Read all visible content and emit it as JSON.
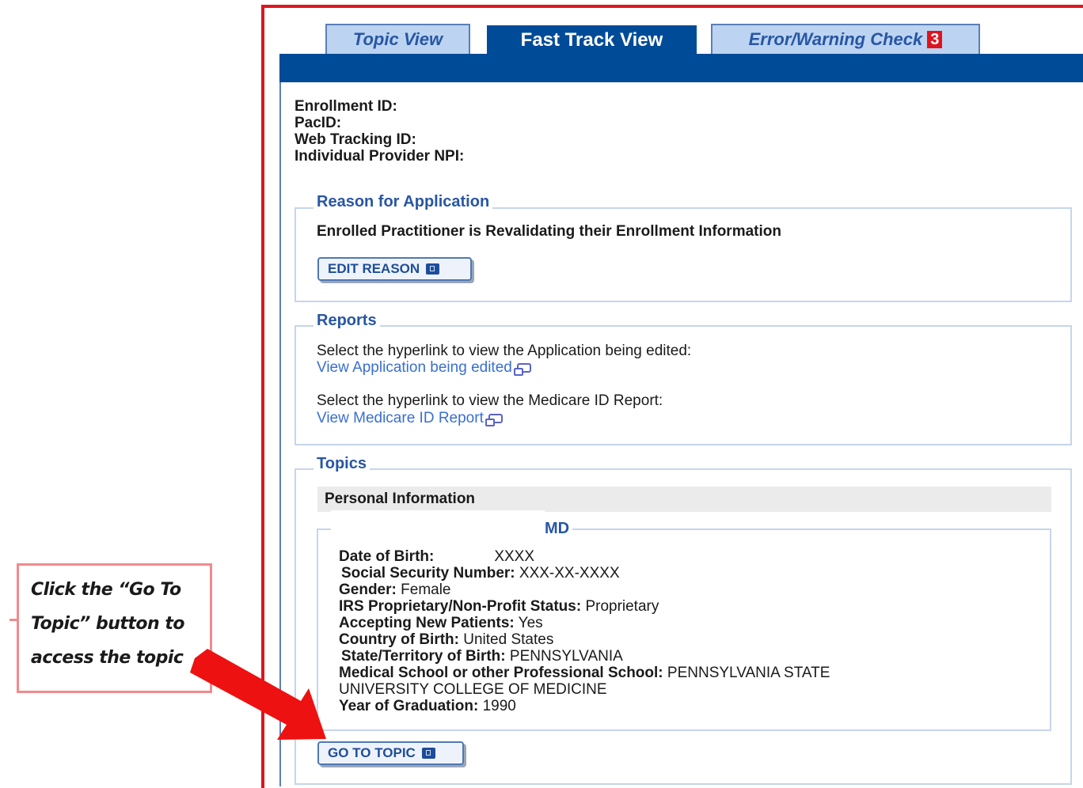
{
  "tabs": [
    {
      "label": "Topic View",
      "active": false
    },
    {
      "label": "Fast Track View",
      "active": true
    },
    {
      "label": "Error/Warning Check",
      "badge": "3",
      "active": false
    }
  ],
  "ids": {
    "enrollment_id": "Enrollment ID:",
    "pac_id": "PacID:",
    "web_tracking_id": "Web Tracking ID:",
    "individual_npi": "Individual Provider NPI:"
  },
  "reason": {
    "legend": "Reason for Application",
    "text": "Enrolled Practitioner is Revalidating their Enrollment Information",
    "button": "EDIT REASON"
  },
  "reports": {
    "legend": "Reports",
    "line1": "Select the hyperlink to view the Application being edited:",
    "link1": "View Application being edited",
    "line2": "Select the hyperlink to view the Medicare ID Report:",
    "link2": "View Medicare ID Report"
  },
  "topics": {
    "legend": "Topics",
    "personal_header": "Personal Information",
    "md_legend": "MD",
    "fields": [
      {
        "label": "Date of Birth:",
        "value": "XXXX"
      },
      {
        "label": "Social Security Number:",
        "value": "XXX-XX-XXXX"
      },
      {
        "label": "Gender:",
        "value": "Female"
      },
      {
        "label": "IRS Proprietary/Non-Profit Status:",
        "value": "Proprietary"
      },
      {
        "label": "Accepting New Patients:",
        "value": "Yes"
      },
      {
        "label": "Country of Birth:",
        "value": "United States"
      },
      {
        "label": "State/Territory of Birth:",
        "value": "PENNSYLVANIA"
      },
      {
        "label": "Medical School or other Professional School:",
        "value": "PENNSYLVANIA STATE"
      },
      {
        "label": "",
        "value": "UNIVERSITY COLLEGE OF MEDICINE"
      },
      {
        "label": "Year of Graduation:",
        "value": "1990"
      }
    ],
    "button": "GO TO TOPIC"
  },
  "callout": {
    "line1": "Click the “Go To",
    "line2": "Topic” button to",
    "line3": "access the topic"
  },
  "colors": {
    "accent_blue": "#004b98",
    "link_blue": "#3a6fd0",
    "frame_red": "#e0141e",
    "arrow_red": "#ee1111"
  }
}
